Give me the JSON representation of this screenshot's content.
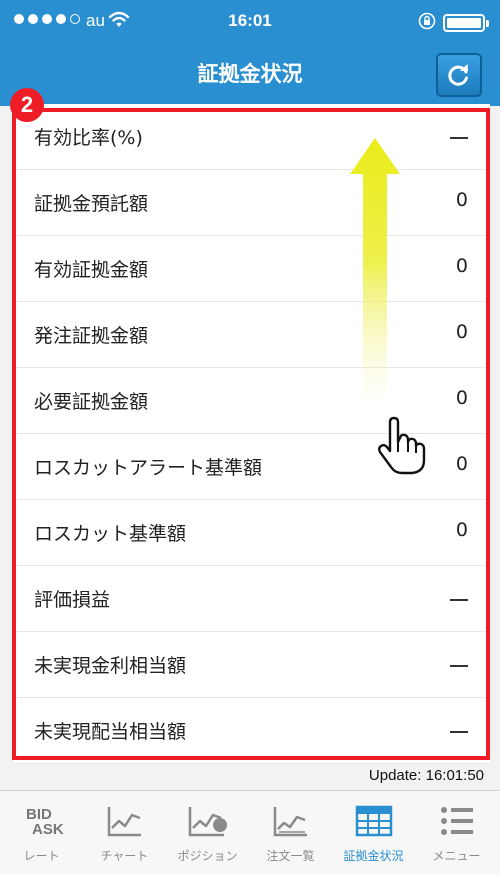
{
  "status_bar": {
    "carrier": "au",
    "time": "16:01"
  },
  "nav": {
    "title": "証拠金状況",
    "refresh_icon": "refresh-icon"
  },
  "badge": "2",
  "rows": [
    {
      "label": "有効比率(%)",
      "value": "—"
    },
    {
      "label": "証拠金預託額",
      "value": "0"
    },
    {
      "label": "有効証拠金額",
      "value": "0"
    },
    {
      "label": "発注証拠金額",
      "value": "0"
    },
    {
      "label": "必要証拠金額",
      "value": "0"
    },
    {
      "label": "ロスカットアラート基準額",
      "value": "0"
    },
    {
      "label": "ロスカット基準額",
      "value": "0"
    },
    {
      "label": "評価損益",
      "value": "—"
    },
    {
      "label": "未実現金利相当額",
      "value": "—"
    },
    {
      "label": "未実現配当相当額",
      "value": "—"
    }
  ],
  "update": "Update: 16:01:50",
  "tabs": [
    {
      "label": "レート",
      "icon": "bid-ask-icon",
      "icon_text_top": "BID",
      "icon_text_bottom": "ASK"
    },
    {
      "label": "チャート",
      "icon": "chart-icon"
    },
    {
      "label": "ポジション",
      "icon": "position-icon"
    },
    {
      "label": "注文一覧",
      "icon": "order-list-icon"
    },
    {
      "label": "証拠金状況",
      "icon": "margin-status-icon",
      "active": true
    },
    {
      "label": "メニュー",
      "icon": "menu-icon"
    }
  ],
  "colors": {
    "header": "#2a8fd0",
    "highlight_frame": "#ee1c25",
    "active_tab": "#2a8fd0"
  }
}
